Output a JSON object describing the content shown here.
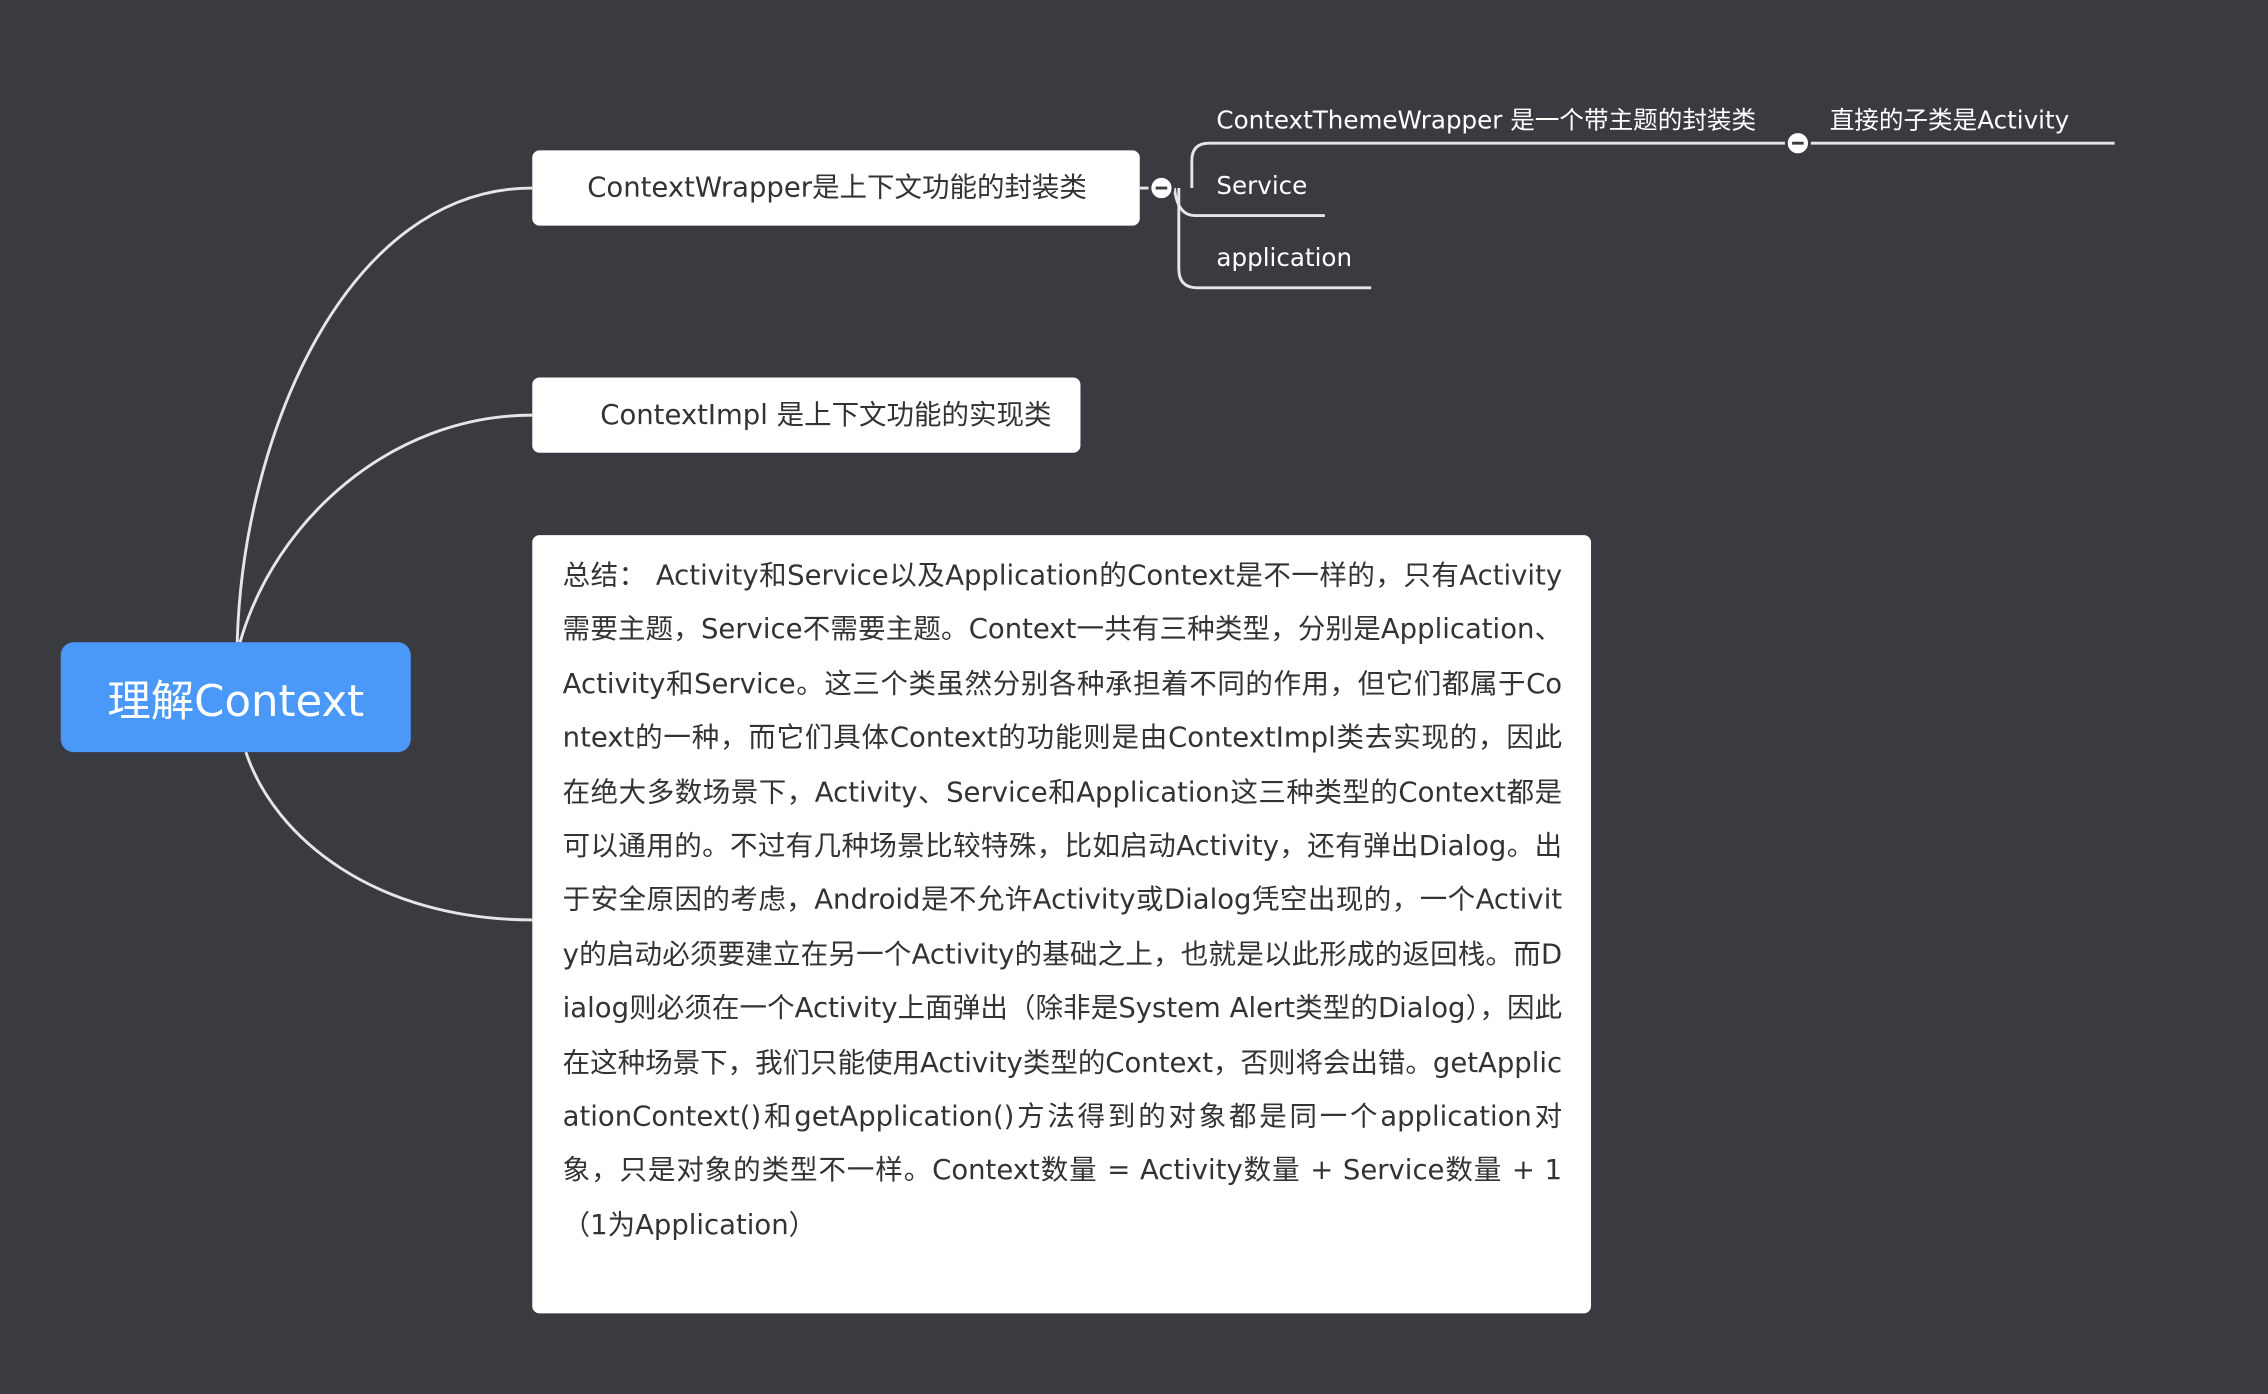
{
  "root": {
    "label": "理解Context"
  },
  "branches": {
    "wrapper": {
      "label": "ContextWrapper是上下文功能的封装类",
      "children": {
        "theme": {
          "label": "ContextThemeWrapper  是一个带主题的封装类",
          "child": "直接的子类是Activity"
        },
        "service": "Service",
        "application": "application"
      }
    },
    "impl": {
      "label": "ContextImpl     是上下文功能的实现类"
    },
    "summary": {
      "text": "总结：   Activity和Service以及Application的Context是不一样的，只有Activity需要主题，Service不需要主题。Context一共有三种类型，分别是Application、Activity和Service。这三个类虽然分别各种承担着不同的作用，但它们都属于Context的一种，而它们具体Context的功能则是由ContextImpl类去实现的，因此在绝大多数场景下，Activity、Service和Application这三种类型的Context都是可以通用的。不过有几种场景比较特殊，比如启动Activity，还有弹出Dialog。出于安全原因的考虑，Android是不允许Activity或Dialog凭空出现的，一个Activity的启动必须要建立在另一个Activity的基础之上，也就是以此形成的返回栈。而Dialog则必须在一个Activity上面弹出（除非是System Alert类型的Dialog），因此在这种场景下，我们只能使用Activity类型的Context，否则将会出错。getApplicationContext()和getApplication()方法得到的对象都是同一个application对象，只是对象的类型不一样。Context数量 = Activity数量 + Service数量 + 1 （1为Application）"
    }
  },
  "colors": {
    "background": "#393b40",
    "root": "#4a98f7",
    "card": "#ffffff",
    "connector": "#e6e6e6"
  }
}
